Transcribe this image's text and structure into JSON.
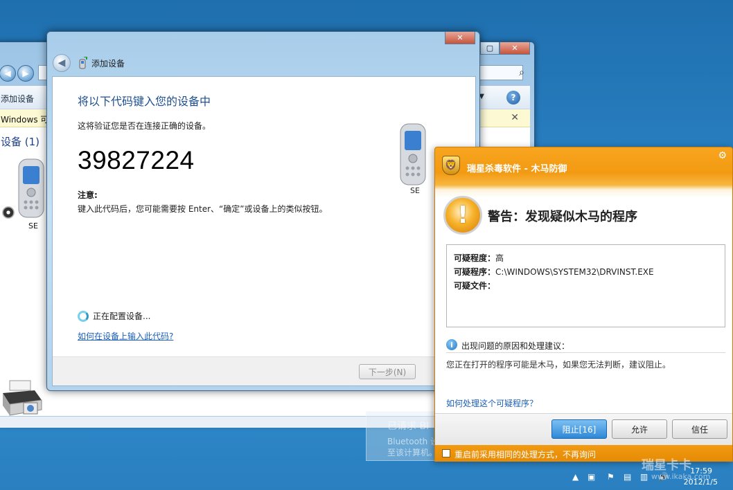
{
  "explorer": {
    "add_device": "添加设备",
    "info_bar": "Windows 可以",
    "group_header": "设备 (1)",
    "device_label": "SE",
    "icons": [
      "back-icon",
      "forward-icon",
      "search-icon",
      "help-icon",
      "close-icon"
    ]
  },
  "wizard": {
    "title": "添加设备",
    "heading": "将以下代码键入您的设备中",
    "verify": "这将验证您是否在连接正确的设备。",
    "code": "39827224",
    "note_label": "注意:",
    "note_text": "键入此代码后，您可能需要按 Enter、“确定”或设备上的类似按钮。",
    "device_label": "SE",
    "configuring": "正在配置设备...",
    "help_link": "如何在设备上输入此代码?",
    "next_button": "下一步(N)"
  },
  "rising": {
    "title": "瑞星杀毒软件 - 木马防御",
    "warning_title": "警告：发现疑似木马的程序",
    "rows": [
      {
        "label": "可疑程度：",
        "value": "高"
      },
      {
        "label": "可疑程序：",
        "value": "C:\\WINDOWS\\SYSTEM32\\DRVINST.EXE"
      },
      {
        "label": "可疑文件：",
        "value": ""
      }
    ],
    "reason_header": "出现问题的原因和处理建议：",
    "reason_text": "您正在打开的程序可能是木马，如果您无法判断，建议阻止。",
    "help_link": "如何处理这个可疑程序？",
    "buttons": {
      "block": "阻止[16]",
      "allow": "允许",
      "trust": "信任"
    },
    "remember": "重启前采用相同的处理方式，不再询问",
    "colors": {
      "accent": "#f29a12",
      "primary_button": "#2d87d6"
    }
  },
  "notice": {
    "line1": "已请求 Bl",
    "line2": "Bluetooth 设",
    "line3": "至该计算机。"
  },
  "tray": {
    "time": "17:59",
    "date": "2012/1/5",
    "watermark": "瑞星卡卡",
    "watermark_url": "www.ikaka.com"
  }
}
